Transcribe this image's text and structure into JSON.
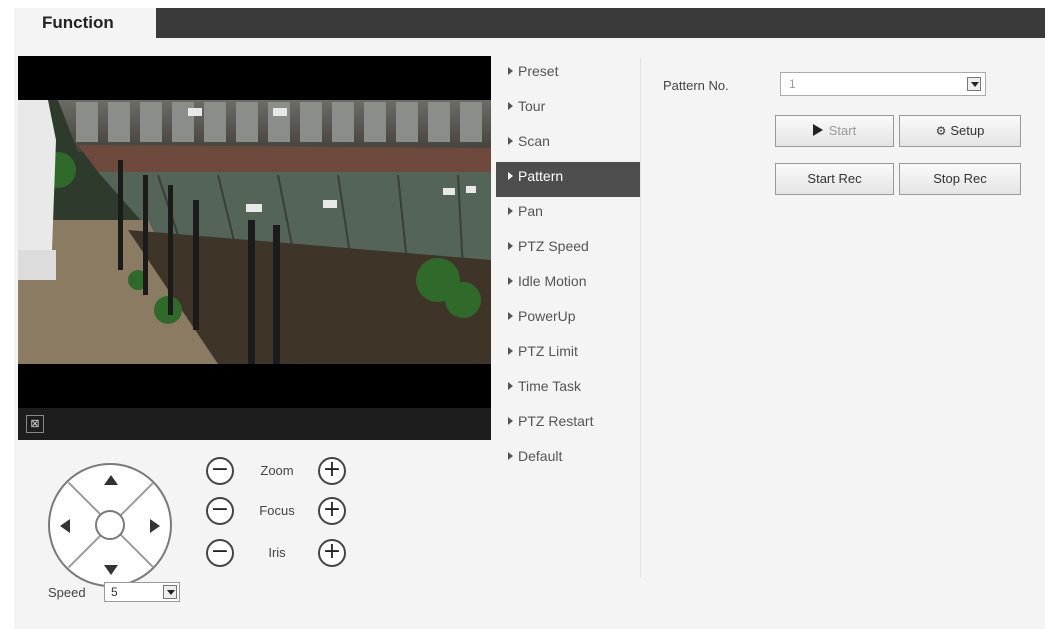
{
  "header": {
    "tab_label": "Function"
  },
  "video": {
    "fullscreen_icon": "fullscreen-icon",
    "fullscreen_glyph": "⊠"
  },
  "ptz": {
    "zoom_label": "Zoom",
    "focus_label": "Focus",
    "iris_label": "Iris",
    "minus_glyph": "−",
    "plus_glyph": "+",
    "speed_label": "Speed",
    "speed_value": "5"
  },
  "menu": {
    "items": [
      {
        "label": "Preset"
      },
      {
        "label": "Tour"
      },
      {
        "label": "Scan"
      },
      {
        "label": "Pattern",
        "active": true
      },
      {
        "label": "Pan"
      },
      {
        "label": "PTZ Speed"
      },
      {
        "label": "Idle Motion"
      },
      {
        "label": "PowerUp"
      },
      {
        "label": "PTZ Limit"
      },
      {
        "label": "Time Task"
      },
      {
        "label": "PTZ Restart"
      },
      {
        "label": "Default"
      }
    ]
  },
  "pattern": {
    "label": "Pattern No.",
    "value": "1",
    "start_label": "Start",
    "setup_label": "Setup",
    "setup_icon": "⚙",
    "start_rec_label": "Start Rec",
    "stop_rec_label": "Stop Rec"
  },
  "colors": {
    "active_menu_bg": "#4e4e4e",
    "topbar_bg": "#3a3a3a"
  }
}
